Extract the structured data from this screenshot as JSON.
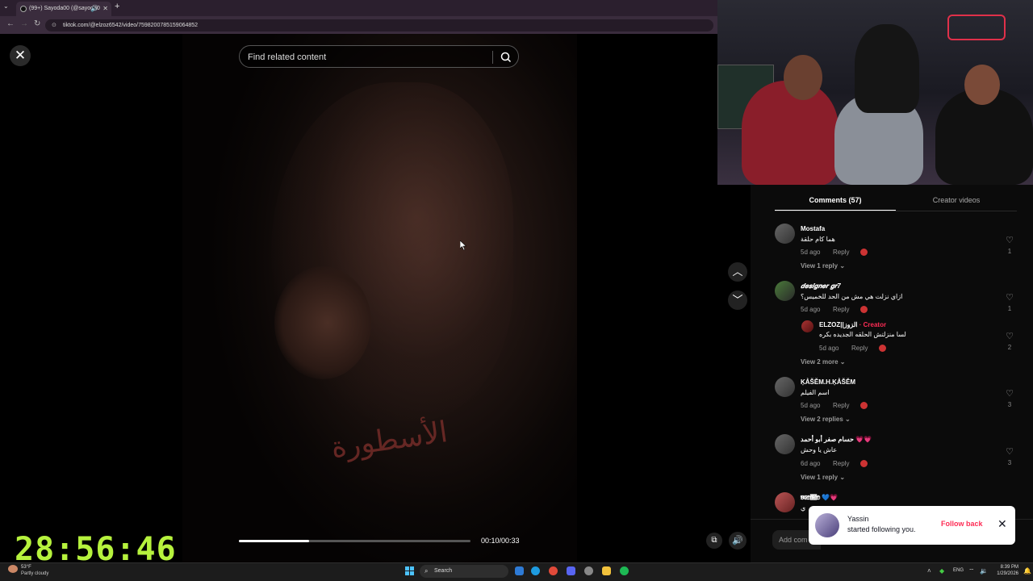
{
  "browser": {
    "tab_title": "(99+) Sayoda00 (@sayoda0",
    "url": "tiktok.com/@elzoz6542/video/7598200785159064852",
    "new_tab": "+"
  },
  "player": {
    "search_placeholder": "Find related content",
    "time": "00:10/00:33",
    "progress_fraction": 0.303,
    "tattoo_text": "الأسطورة"
  },
  "panel": {
    "tabs": [
      "Comments (57)",
      "Creator videos"
    ],
    "active_tab": 0,
    "reply_label": "Reply",
    "add_comment_placeholder": "Add com",
    "comments": [
      {
        "name": "Mostafa",
        "text": "هما كام حلقة",
        "time": "5d ago",
        "likes": "1",
        "view": "View 1 reply"
      },
      {
        "name": "𝒅𝒆𝒔𝒊𝒈𝒏𝒆𝒓 𝒈𝒓7",
        "text": "ازاي نزلت هي مش من الحد للخميس؟",
        "time": "5d ago",
        "likes": "1"
      },
      {
        "name": "ELZOZ||الزوز",
        "creator": "· Creator",
        "text": "لسا منزلتش الحلقه الجديده بكره",
        "time": "5d ago",
        "likes": "2",
        "view": "View 2 more"
      },
      {
        "name": "ĶẢŠĚM.H.ĶẢŠĚM",
        "text": "اسم الفيلم",
        "time": "5d ago",
        "likes": "3",
        "view": "View 2 replies"
      },
      {
        "name": "حسام صفر أبو أحمد 💗💗",
        "text": "عاش يا وحش",
        "time": "6d ago",
        "likes": "3",
        "view": "View 1 reply"
      },
      {
        "name": "𝔅𝔈𝔇𝔕𝔇 💙💗",
        "text": "ي"
      }
    ]
  },
  "toast": {
    "name": "Yassin",
    "message": "started following you.",
    "action": "Follow back"
  },
  "timer": "28:56:46",
  "taskbar": {
    "weather_temp": "53°F",
    "weather_desc": "Partly cloudy",
    "search_label": "Search",
    "lang": "ENG",
    "time": "8:39 PM",
    "date": "1/29/2026"
  },
  "colors": {
    "accent": "#fe2c55",
    "timer": "#b6f23d"
  }
}
